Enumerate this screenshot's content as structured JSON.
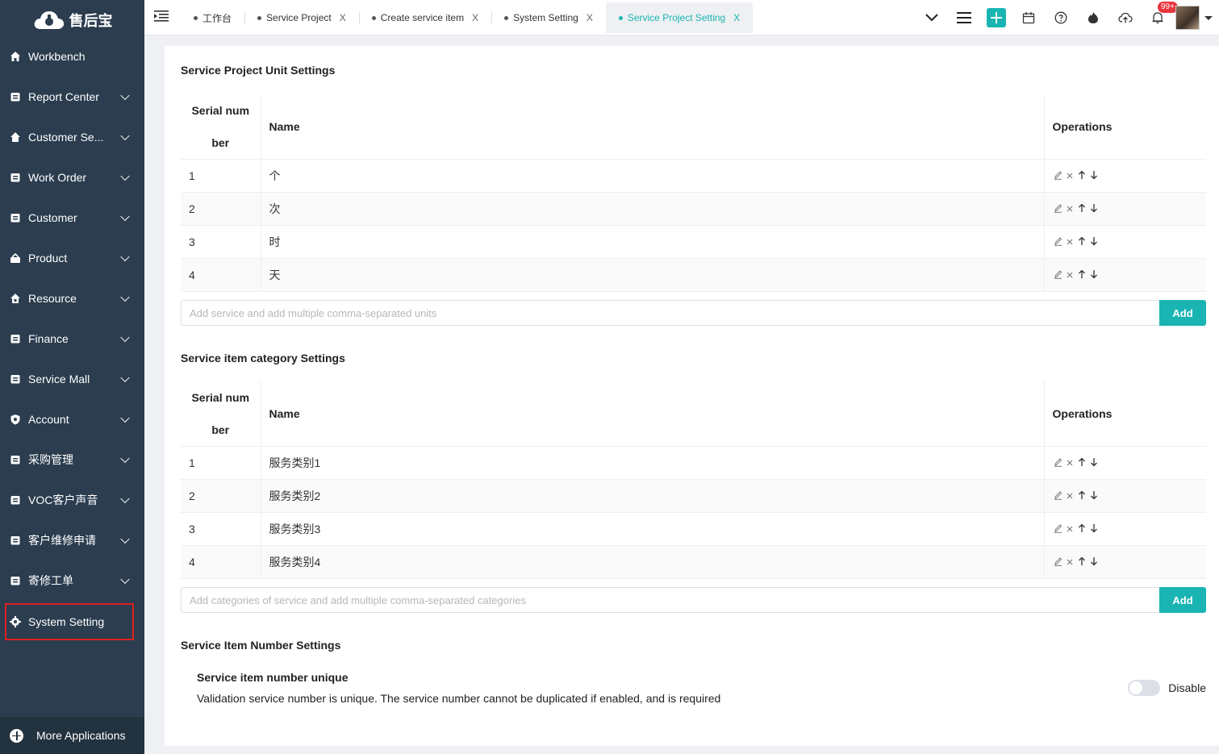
{
  "app": {
    "logo_text": "售后宝"
  },
  "sidebar": {
    "items": [
      {
        "label": "Workbench",
        "icon": "home-icon",
        "chevron": false
      },
      {
        "label": "Report Center",
        "icon": "report-icon",
        "chevron": true
      },
      {
        "label": "Customer Se...",
        "icon": "customer-service-icon",
        "chevron": true
      },
      {
        "label": "Work Order",
        "icon": "work-order-icon",
        "chevron": true
      },
      {
        "label": "Customer",
        "icon": "customer-icon",
        "chevron": true
      },
      {
        "label": "Product",
        "icon": "product-icon",
        "chevron": true
      },
      {
        "label": "Resource",
        "icon": "resource-icon",
        "chevron": true
      },
      {
        "label": "Finance",
        "icon": "finance-icon",
        "chevron": true
      },
      {
        "label": "Service Mall",
        "icon": "mall-icon",
        "chevron": true
      },
      {
        "label": "Account",
        "icon": "account-icon",
        "chevron": true
      },
      {
        "label": "采购管理",
        "icon": "purchase-icon",
        "chevron": true
      },
      {
        "label": "VOC客户声音",
        "icon": "voc-icon",
        "chevron": true
      },
      {
        "label": "客户维修申请",
        "icon": "repair-request-icon",
        "chevron": true
      },
      {
        "label": "寄修工单",
        "icon": "mail-repair-icon",
        "chevron": true
      },
      {
        "label": "System Setting",
        "icon": "gear-icon",
        "chevron": false,
        "active": true
      }
    ],
    "more_apps": "More Applications"
  },
  "tabs": [
    {
      "label": "工作台",
      "closable": false
    },
    {
      "label": "Service Project",
      "closable": true
    },
    {
      "label": "Create service item",
      "closable": true
    },
    {
      "label": "System Setting",
      "closable": true
    },
    {
      "label": "Service Project Setting",
      "closable": true,
      "active": true
    }
  ],
  "header": {
    "notifications_badge": "99+",
    "close_glyph": "X"
  },
  "units": {
    "title": "Service Project Unit Settings",
    "col_serial": "Serial number",
    "col_name": "Name",
    "col_ops": "Operations",
    "rows": [
      {
        "sn": "1",
        "name": "个"
      },
      {
        "sn": "2",
        "name": "次"
      },
      {
        "sn": "3",
        "name": "时"
      },
      {
        "sn": "4",
        "name": "天"
      }
    ],
    "input_placeholder": "Add service and add multiple comma-separated units",
    "add_label": "Add"
  },
  "categories": {
    "title": "Service item category Settings",
    "col_serial": "Serial number",
    "col_name": "Name",
    "col_ops": "Operations",
    "rows": [
      {
        "sn": "1",
        "name": "服务类别1"
      },
      {
        "sn": "2",
        "name": "服务类别2"
      },
      {
        "sn": "3",
        "name": "服务类别3"
      },
      {
        "sn": "4",
        "name": "服务类别4"
      }
    ],
    "input_placeholder": "Add categories of service and add multiple comma-separated categories",
    "add_label": "Add"
  },
  "number_settings": {
    "title": "Service Item Number Settings",
    "setting_name": "Service item number unique",
    "setting_desc": "Validation service number is unique. The service number cannot be duplicated if enabled, and is required",
    "toggle_label": "Disable",
    "enabled": false
  },
  "colors": {
    "sidebar": "#2b3d4f",
    "accent": "#1ab5b2",
    "badge": "#e8343b"
  }
}
